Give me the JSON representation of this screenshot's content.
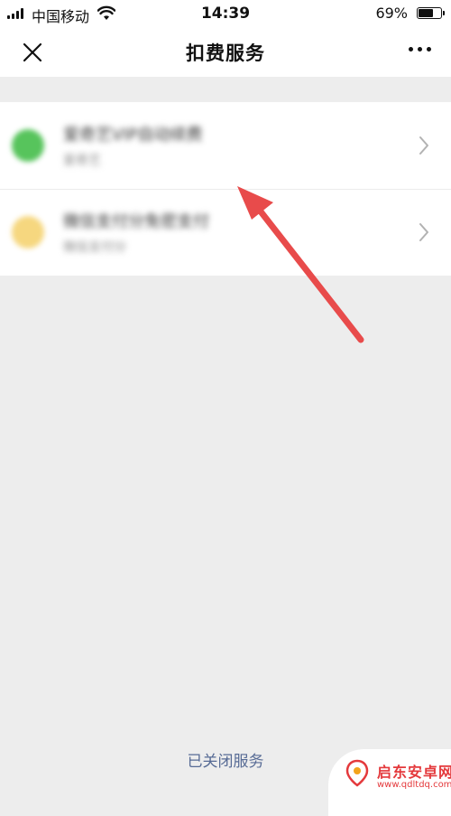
{
  "status_bar": {
    "carrier": "中国移动",
    "time": "14:39",
    "battery_percent_text": "69%",
    "battery_level": 0.69
  },
  "nav": {
    "title": "扣费服务",
    "close_icon": "close-icon",
    "more_icon": "more-icon"
  },
  "services": [
    {
      "title": "爱奇艺VIP自动续费",
      "subtitle": "爱奇艺",
      "icon_color": "#57c45c"
    },
    {
      "title": "微信支付分免密支付",
      "subtitle": "微信支付分",
      "icon_color": "#f6d77f"
    }
  ],
  "footer": {
    "closed_services_label": "已关闭服务"
  },
  "watermark": {
    "name": "启东安卓网",
    "url": "www.qdltdq.com"
  },
  "colors": {
    "background": "#ededed",
    "link": "#576b95",
    "annotation_arrow": "#e84b4b"
  }
}
